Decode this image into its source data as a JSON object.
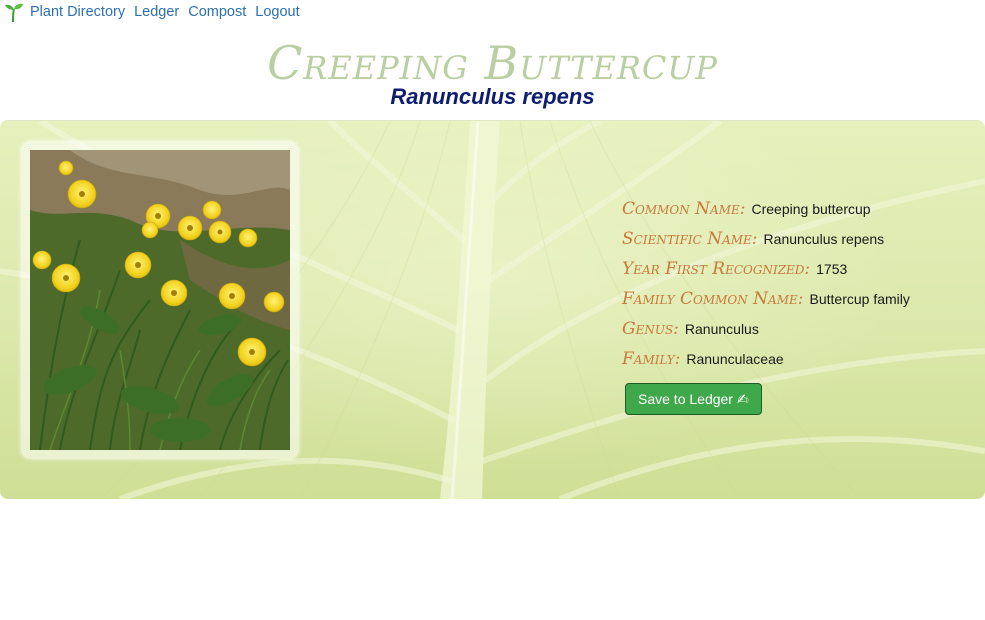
{
  "nav": {
    "items": [
      {
        "label": "Plant Directory"
      },
      {
        "label": "Ledger"
      },
      {
        "label": "Compost"
      },
      {
        "label": "Logout"
      }
    ],
    "logo_icon": "sprout-icon"
  },
  "plant": {
    "title": "Creeping Buttercup",
    "scientific": "Ranunculus repens",
    "photo_icon": "buttercup-photo"
  },
  "details": [
    {
      "label": "Common Name:",
      "value": "Creeping buttercup"
    },
    {
      "label": "Scientific Name:",
      "value": "Ranunculus repens"
    },
    {
      "label": "Year First Recognized:",
      "value": "1753"
    },
    {
      "label": "Family Common Name:",
      "value": "Buttercup family"
    },
    {
      "label": "Genus:",
      "value": "Ranunculus"
    },
    {
      "label": "Family:",
      "value": "Ranunculaceae"
    }
  ],
  "actions": {
    "save_label": "Save to Ledger",
    "save_icon": "✍",
    "save_color": "#3fa84a"
  },
  "colors": {
    "title": "#b9cfa2",
    "subtitle": "#0e1e6e",
    "label": "#c77a3a",
    "link": "#2d6fb3"
  }
}
